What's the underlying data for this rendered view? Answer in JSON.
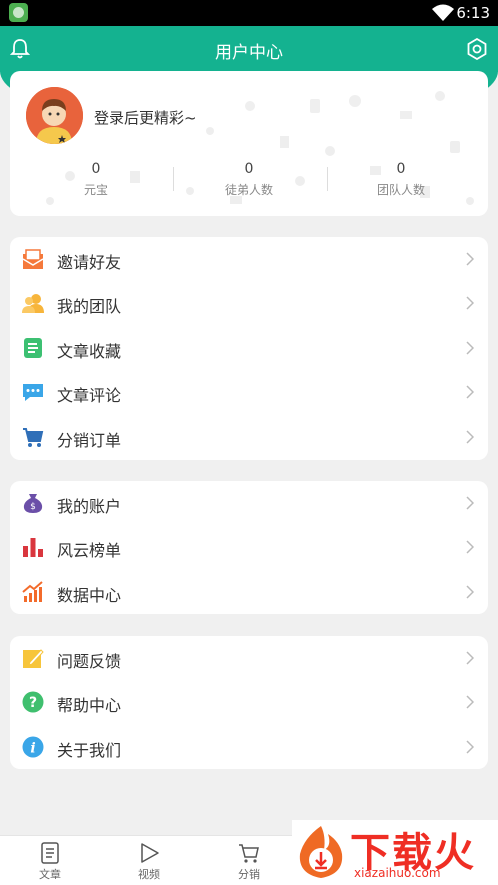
{
  "status_bar": {
    "time": "6:13"
  },
  "header": {
    "title": "用户中心"
  },
  "profile": {
    "login_prompt": "登录后更精彩~",
    "stats": [
      {
        "value": "0",
        "label": "元宝"
      },
      {
        "value": "0",
        "label": "徒弟人数"
      },
      {
        "value": "0",
        "label": "团队人数"
      }
    ]
  },
  "menu_group_1": [
    {
      "label": "邀请好友",
      "icon": "invite-envelope-icon"
    },
    {
      "label": "我的团队",
      "icon": "team-people-icon"
    },
    {
      "label": "文章收藏",
      "icon": "article-doc-icon"
    },
    {
      "label": "文章评论",
      "icon": "comment-bubble-icon"
    },
    {
      "label": "分销订单",
      "icon": "shopping-cart-icon"
    }
  ],
  "menu_group_2": [
    {
      "label": "我的账户",
      "icon": "money-bag-icon"
    },
    {
      "label": "风云榜单",
      "icon": "bar-chart-icon"
    },
    {
      "label": "数据中心",
      "icon": "trend-chart-icon"
    }
  ],
  "menu_group_3": [
    {
      "label": "问题反馈",
      "icon": "feedback-pencil-icon"
    },
    {
      "label": "帮助中心",
      "icon": "help-question-icon"
    },
    {
      "label": "关于我们",
      "icon": "info-icon"
    }
  ],
  "bottom_tabs": [
    {
      "label": "文章",
      "icon": "article-tab-icon"
    },
    {
      "label": "视频",
      "icon": "video-play-icon"
    },
    {
      "label": "分销",
      "icon": "cart-tab-icon"
    }
  ],
  "watermark": {
    "brand_cn": "下载火",
    "brand_en": "xiazaihuo.com"
  },
  "colors": {
    "primary": "#14b290",
    "background": "#f0f0f0",
    "watermark": "#ef2e24"
  }
}
